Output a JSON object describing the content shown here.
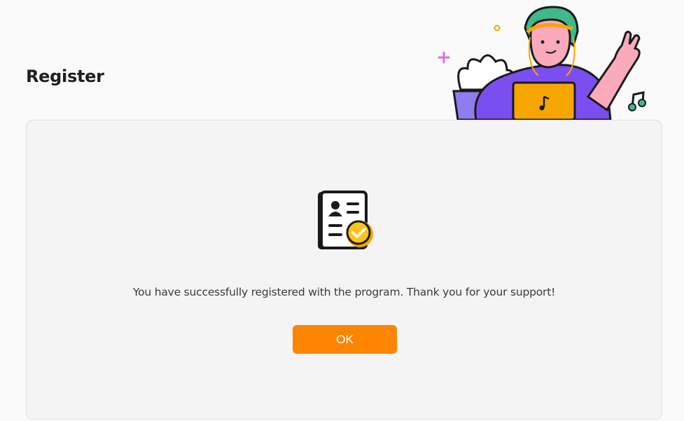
{
  "page": {
    "title": "Register"
  },
  "dialog": {
    "message": "You have successfully registered with the program. Thank you for your support!",
    "ok_label": "OK",
    "icon": "registration-document-check-icon"
  },
  "illustration": {
    "icon": "person-with-laptop-music-illustration"
  },
  "colors": {
    "accent": "#fb8500",
    "card_background": "#f4f4f4",
    "illustration_purple": "#7b4ef0",
    "laptop_yellow": "#f7a500",
    "skin_pink": "#fbaabc",
    "hair_green": "#3fb98a"
  }
}
